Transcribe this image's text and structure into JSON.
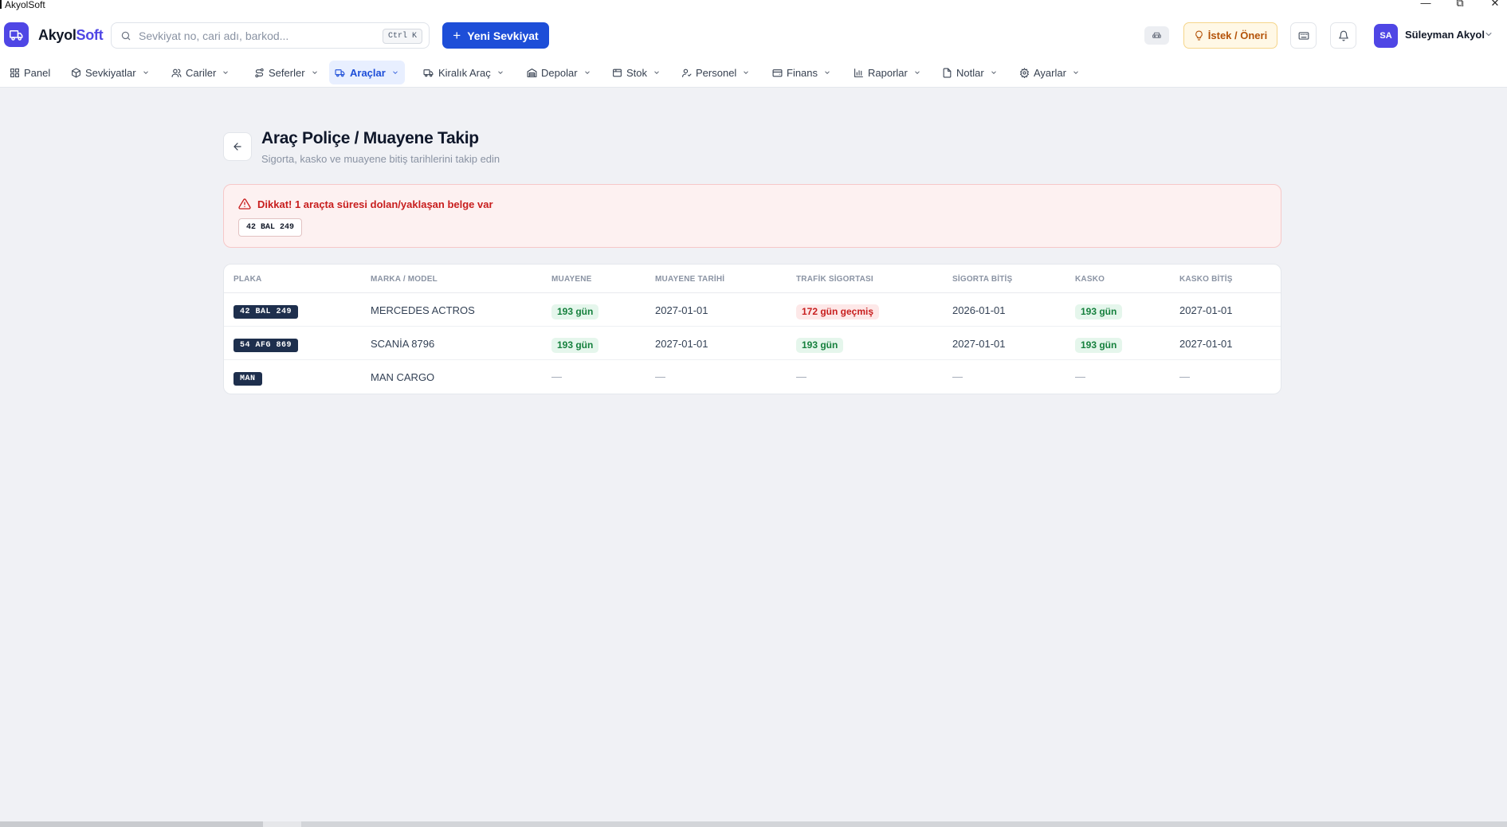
{
  "window": {
    "title": "AkyolSoft",
    "minimize": "—",
    "maximize": "⧉",
    "close": "✕"
  },
  "header": {
    "brand_part1": "Akyol",
    "brand_part2": "Soft",
    "search_placeholder": "Sevkiyat no, cari adı, barkod...",
    "search_shortcut": "Ctrl K",
    "new_button": "Yeni Sevkiyat",
    "suggest_button": "İstek / Öneri",
    "user_initials": "SA",
    "user_name": "Süleyman Akyol"
  },
  "nav": {
    "items": [
      {
        "label": "Panel",
        "icon": "grid-icon",
        "dropdown": false
      },
      {
        "label": "Sevkiyatlar",
        "icon": "package-icon",
        "dropdown": true
      },
      {
        "label": "Cariler",
        "icon": "users-icon",
        "dropdown": true
      },
      {
        "label": "Seferler",
        "icon": "route-icon",
        "dropdown": true
      },
      {
        "label": "Araçlar",
        "icon": "truck-icon",
        "dropdown": true,
        "active": true
      },
      {
        "label": "Kiralık Araç",
        "icon": "truck-icon",
        "dropdown": true
      },
      {
        "label": "Depolar",
        "icon": "warehouse-icon",
        "dropdown": true
      },
      {
        "label": "Stok",
        "icon": "box-icon",
        "dropdown": true
      },
      {
        "label": "Personel",
        "icon": "user-icon",
        "dropdown": true
      },
      {
        "label": "Finans",
        "icon": "wallet-icon",
        "dropdown": true
      },
      {
        "label": "Raporlar",
        "icon": "bar-chart-icon",
        "dropdown": true
      },
      {
        "label": "Notlar",
        "icon": "file-icon",
        "dropdown": true
      },
      {
        "label": "Ayarlar",
        "icon": "gear-icon",
        "dropdown": true
      }
    ]
  },
  "page": {
    "title": "Araç Poliçe / Muayene Takip",
    "subtitle": "Sigorta, kasko ve muayene bitiş tarihlerini takip edin"
  },
  "alert": {
    "message": "Dikkat! 1 araçta süresi dolan/yaklaşan belge var",
    "plates": [
      "42 BAL 249"
    ]
  },
  "table": {
    "columns": [
      "PLAKA",
      "MARKA / MODEL",
      "MUAYENE",
      "MUAYENE TARİHİ",
      "TRAFİK SİGORTASI",
      "SİGORTA BİTİŞ",
      "KASKO",
      "KASKO BİTİŞ"
    ],
    "rows": [
      {
        "plate": "42 BAL 249",
        "model": "MERCEDES ACTROS",
        "muayene": "193 gün",
        "muayene_status": "ok",
        "muayene_date": "2027-01-01",
        "trafik": "172 gün geçmiş",
        "trafik_status": "bad",
        "sigorta_date": "2026-01-01",
        "kasko": "193 gün",
        "kasko_status": "ok",
        "kasko_date": "2027-01-01"
      },
      {
        "plate": "54 AFG 869",
        "model": "SCANİA 8796",
        "muayene": "193 gün",
        "muayene_status": "ok",
        "muayene_date": "2027-01-01",
        "trafik": "193 gün",
        "trafik_status": "ok",
        "sigorta_date": "2027-01-01",
        "kasko": "193 gün",
        "kasko_status": "ok",
        "kasko_date": "2027-01-01"
      },
      {
        "plate": "MAN",
        "model": "MAN CARGO",
        "muayene": "—",
        "muayene_date": "—",
        "trafik": "—",
        "sigorta_date": "—",
        "kasko": "—",
        "kasko_date": "—"
      }
    ]
  },
  "colors": {
    "accent": "#1d4ed8",
    "brand": "#4f46e5",
    "danger": "#c81e1e",
    "success": "#15803d",
    "plate_bg": "#1e2f4d"
  }
}
